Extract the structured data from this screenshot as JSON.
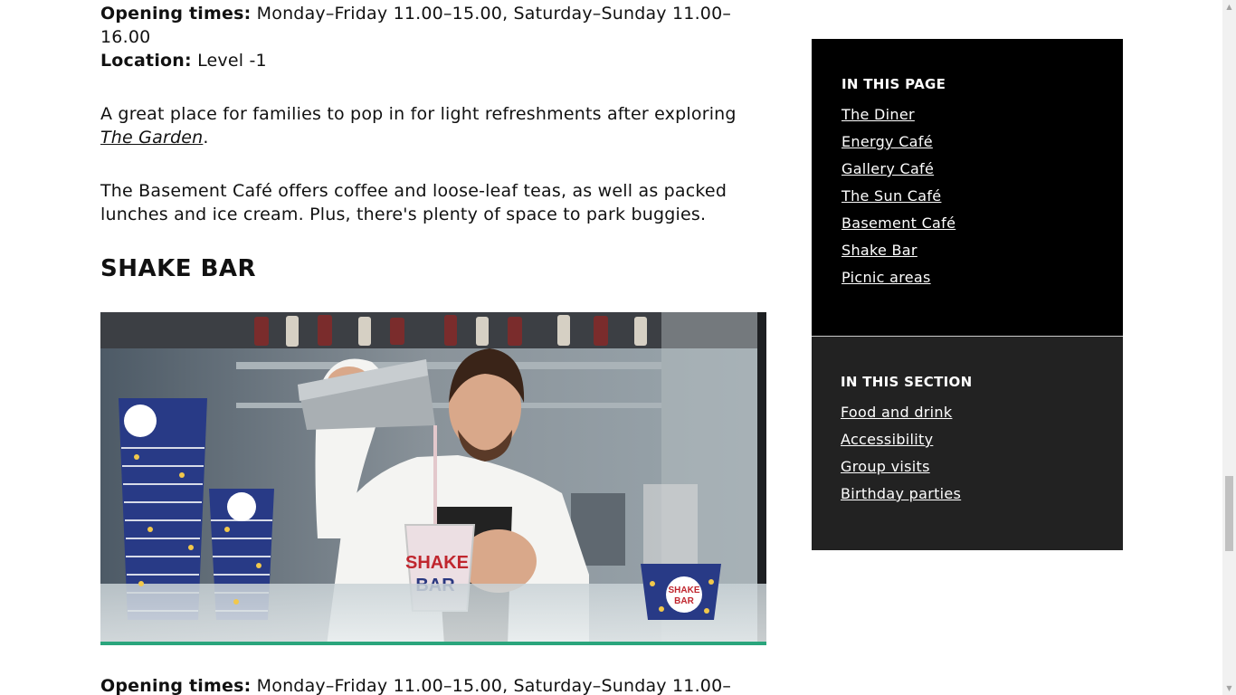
{
  "top_info": {
    "opening_label": "Opening times:",
    "opening_value": " Monday–Friday 11.00–15.00, Saturday–Sunday 11.00–16.00",
    "location_label": "Location:",
    "location_value": " Level -1"
  },
  "para1": {
    "text_before": "A great place for families to pop in for light refreshments after exploring ",
    "link": "The Garden",
    "text_after": "."
  },
  "para2": "The Basement Café offers coffee and loose-leaf teas, as well as packed lunches and ice cream. Plus, there's plenty of space to park buggies.",
  "shake_bar": {
    "heading": "SHAKE BAR",
    "cup_text_1": "SHAKE",
    "cup_text_2": "BAR"
  },
  "bottom_info": {
    "opening_label": "Opening times:",
    "opening_value": " Monday–Friday 11.00–15.00, Saturday–Sunday 11.00–"
  },
  "sidebar": {
    "page_title": "IN THIS PAGE",
    "page_links": [
      "The Diner",
      "Energy Café",
      "Gallery Café",
      "The Sun Café",
      "Basement Café",
      "Shake Bar",
      "Picnic areas"
    ],
    "section_title": "IN THIS SECTION",
    "section_links": [
      "Food and drink",
      "Accessibility",
      "Group visits",
      "Birthday parties"
    ]
  },
  "colors": {
    "sidebar_primary": "#000000",
    "sidebar_secondary": "#222222",
    "text": "#111111"
  }
}
